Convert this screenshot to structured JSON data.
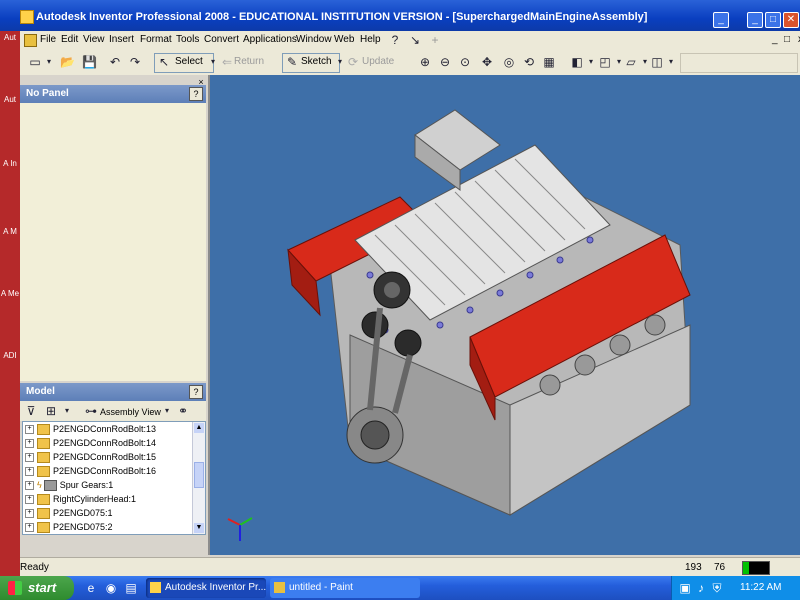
{
  "window": {
    "title": "Autodesk Inventor Professional 2008 - EDUCATIONAL INSTITUTION VERSION - [SuperchargedMainEngineAssembly]",
    "btn_min": "_",
    "btn_max": "□",
    "btn_close": "✕"
  },
  "menu": {
    "items": [
      "File",
      "Edit",
      "View",
      "Insert",
      "Format",
      "Tools",
      "Convert",
      "Applications",
      "Window",
      "Web",
      "Help"
    ],
    "right_min": "_",
    "right_restore": "□",
    "right_close": "x"
  },
  "toolbar": {
    "select_label": "Select",
    "return_label": "Return",
    "sketch_label": "Sketch",
    "update_label": "Update"
  },
  "desktop_left": [
    "Aut",
    "Aut",
    "A In",
    "A M",
    "A Me",
    "ADI"
  ],
  "panel": {
    "title": "No Panel",
    "help": "?",
    "close": "×"
  },
  "model": {
    "title": "Model",
    "help": "?",
    "view_label": "Assembly View",
    "tree": [
      {
        "expand": "+",
        "label": "P2ENGDConnRodBolt:13",
        "icon": "folder"
      },
      {
        "expand": "+",
        "label": "P2ENGDConnRodBolt:14",
        "icon": "folder"
      },
      {
        "expand": "+",
        "label": "P2ENGDConnRodBolt:15",
        "icon": "folder"
      },
      {
        "expand": "+",
        "label": "P2ENGDConnRodBolt:16",
        "icon": "folder"
      },
      {
        "expand": "+",
        "label": "Spur Gears:1",
        "icon": "gear"
      },
      {
        "expand": "+",
        "label": "RightCylinderHead:1",
        "icon": "folder"
      },
      {
        "expand": "+",
        "label": "P2ENGD075:1",
        "icon": "folder"
      },
      {
        "expand": "+",
        "label": "P2ENGD075:2",
        "icon": "folder"
      }
    ]
  },
  "status": {
    "text": "Ready",
    "x": "193",
    "y": "76"
  },
  "taskbar": {
    "start": "start",
    "items": [
      "Autodesk Inventor Pr...",
      "untitled - Paint"
    ],
    "time": "11:22 AM"
  },
  "colors": {
    "viewport_bg": "#3e6fa8",
    "cylinder_head": "#d82a1a"
  }
}
